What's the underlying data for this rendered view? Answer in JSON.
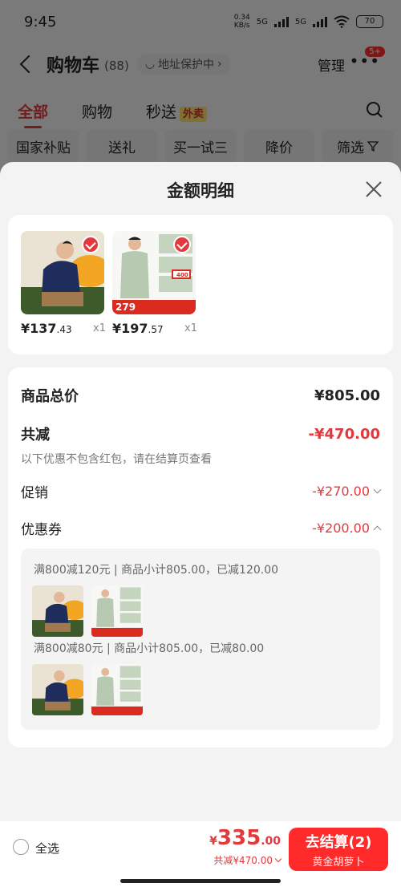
{
  "status_bar": {
    "time": "9:45",
    "net_speed": "0.34",
    "net_unit": "KB/s",
    "sim1": "5G",
    "sim2": "5G",
    "battery": "70"
  },
  "header": {
    "title": "购物车",
    "count": "(88)",
    "address_label": "地址保护中",
    "manage_label": "管理",
    "badge": "5+"
  },
  "tabs": [
    {
      "label": "全部",
      "active": true
    },
    {
      "label": "购物",
      "active": false
    },
    {
      "label": "秒送",
      "active": false,
      "tag": "外卖"
    }
  ],
  "filters": [
    "国家补贴",
    "送礼",
    "买一试三",
    "降价",
    "筛选"
  ],
  "sheet": {
    "title": "金额明细",
    "products": [
      {
        "price_int": "¥137",
        "price_dec": ".43",
        "qty": "x1"
      },
      {
        "price_int": "¥197",
        "price_dec": ".57",
        "qty": "x1",
        "tag": "279",
        "tag2": "400"
      }
    ],
    "summary": {
      "total_label": "商品总价",
      "total_value": "¥805.00",
      "discount_label": "共减",
      "discount_value": "-¥470.00",
      "note": "以下优惠不包含红包，请在结算页查看",
      "promo_label": "促销",
      "promo_value": "-¥270.00",
      "coupon_label": "优惠券",
      "coupon_value": "-¥200.00"
    },
    "coupons": [
      {
        "text": "满800减120元 | 商品小计805.00，已减120.00"
      },
      {
        "text": "满800减80元 | 商品小计805.00，已减80.00"
      }
    ]
  },
  "bottom_bar": {
    "select_all": "全选",
    "price_cur": "¥",
    "price_int": "335",
    "price_dec": ".00",
    "discount_text": "共减¥470.00",
    "checkout_label": "去结算(2)",
    "checkout_sub": "黄金胡萝卜"
  },
  "colors": {
    "accent": "#e4393c",
    "checkout": "#ff2a2a"
  }
}
